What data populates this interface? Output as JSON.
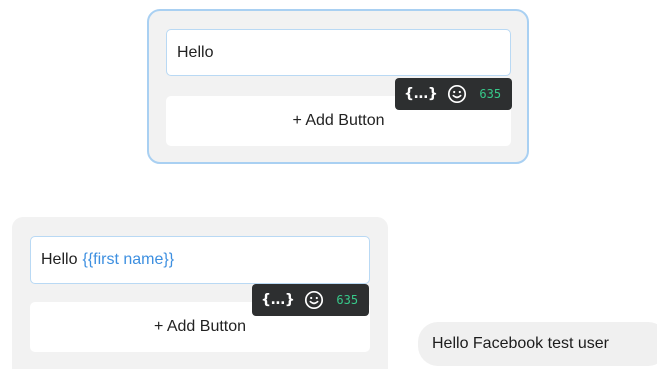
{
  "card_selected": {
    "text_value": "Hello",
    "add_button_label": "+ Add Button",
    "toolbar": {
      "variable_label": "{...}",
      "emoji_icon": "smiley-icon",
      "char_counter": "635"
    }
  },
  "card_second": {
    "text_prefix": "Hello",
    "variable_token": "{{first name}}",
    "add_button_label": "+ Add Button",
    "toolbar": {
      "variable_label": "{...}",
      "emoji_icon": "smiley-icon",
      "char_counter": "635"
    }
  },
  "preview": {
    "message": "Hello Facebook test user"
  },
  "colors": {
    "card_background": "#f2f2f2",
    "selected_border": "#a9d0f2",
    "variable_token": "#3d8fe0",
    "toolbar_background": "#2d2f30",
    "counter_text": "#37c98a"
  }
}
